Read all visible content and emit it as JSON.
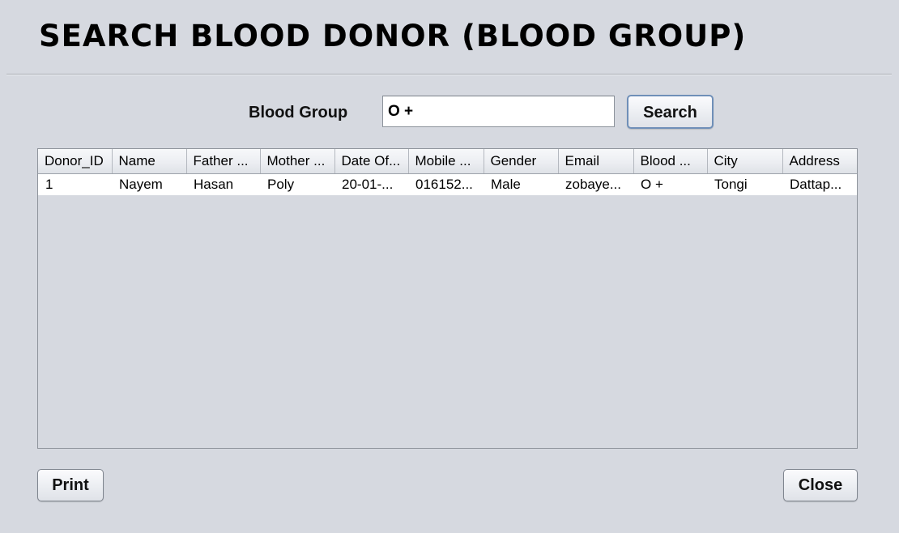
{
  "window": {
    "title": "SEARCH BLOOD DONOR (BLOOD GROUP)"
  },
  "search": {
    "label": "Blood Group",
    "value": "O +",
    "button_label": "Search"
  },
  "table": {
    "columns": [
      "Donor_ID",
      "Name",
      "Father ...",
      "Mother ...",
      "Date Of...",
      "Mobile ...",
      "Gender",
      "Email",
      "Blood ...",
      "City",
      "Address"
    ],
    "rows": [
      [
        "1",
        "Nayem",
        "Hasan",
        "Poly",
        "20-01-...",
        "016152...",
        "Male",
        "zobaye...",
        "O +",
        "Tongi",
        "Dattap..."
      ]
    ]
  },
  "footer": {
    "print_label": "Print",
    "close_label": "Close"
  }
}
